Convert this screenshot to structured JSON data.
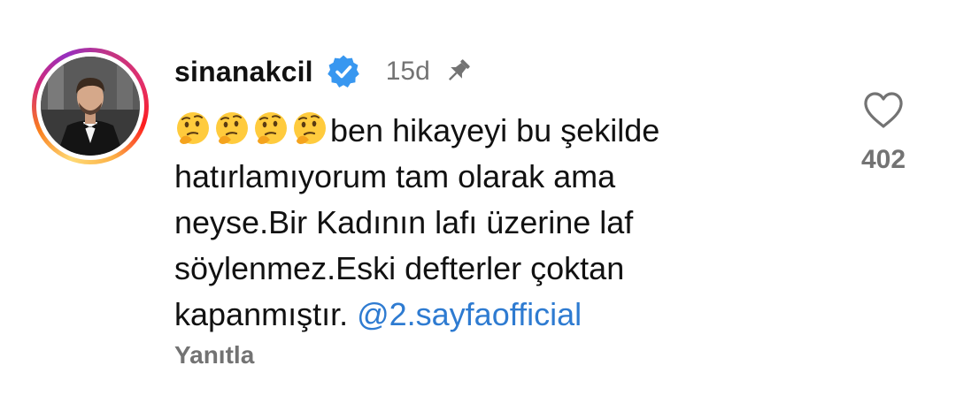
{
  "comment": {
    "username": "sinanakcil",
    "verified_icon": "verified-badge-icon",
    "time": "15d",
    "pin_icon": "pin-icon",
    "emoji_icon": "thinking-face-icon",
    "emoji_count": 4,
    "line1": "ben hikayeyi bu şekilde",
    "line2": "hatırlamıyorum tam olarak ama",
    "line3": "neyse.Bir Kadının lafı üzerine laf",
    "line4": "söylenmez.Eski defterler çoktan",
    "line5": "kapanmıştır. ",
    "mention": "@2.sayfaofficial",
    "reply_label": "Yanıtla"
  },
  "like": {
    "icon": "heart-outline-icon",
    "count": "402"
  },
  "colors": {
    "text": "#111111",
    "secondary": "#737373",
    "mention": "#2e7bd1",
    "verified": "#3897f0"
  }
}
